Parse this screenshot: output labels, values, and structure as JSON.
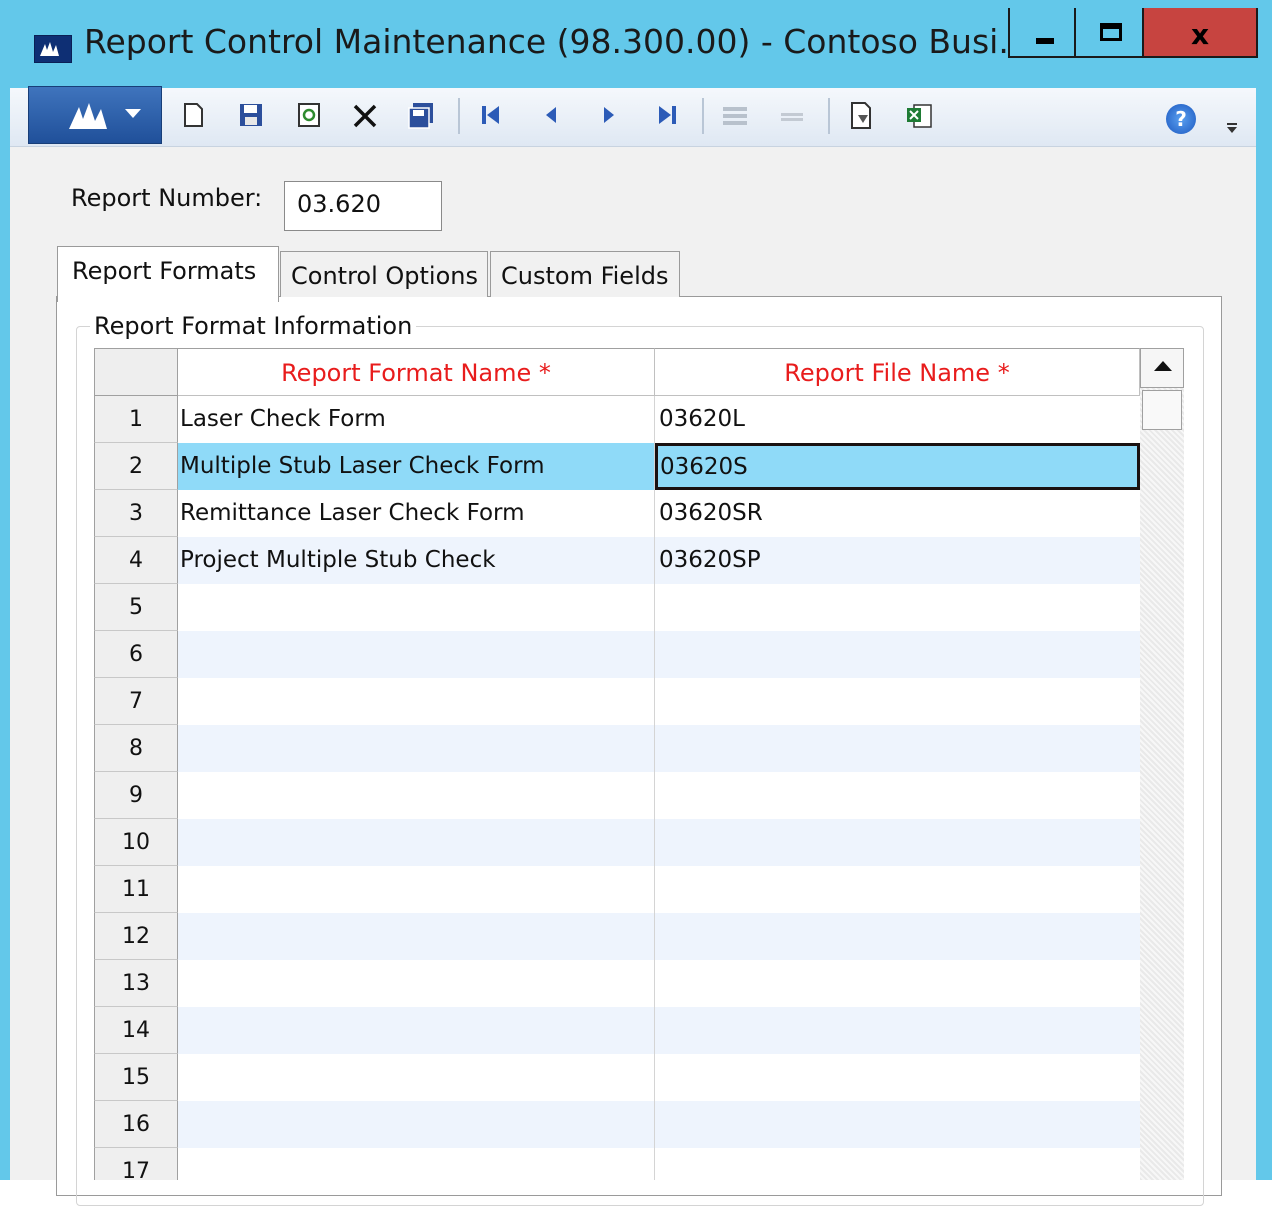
{
  "window": {
    "title": "Report Control Maintenance (98.300.00) - Contoso Busi...",
    "minimize_glyph": "",
    "close_glyph": "x"
  },
  "toolbar": {
    "menu_icon": "dynamics-menu-icon",
    "icons": [
      "new-icon",
      "save-icon",
      "refresh-icon",
      "delete-icon",
      "save-all-icon",
      "first-record-icon",
      "previous-record-icon",
      "next-record-icon",
      "last-record-icon",
      "insert-row-icon",
      "delete-row-icon",
      "print-icon",
      "export-excel-icon"
    ],
    "help_icon": "?"
  },
  "form": {
    "report_number_label": "Report Number:",
    "report_number_value": "03.620"
  },
  "tabs": [
    {
      "label": "Report Formats",
      "active": true
    },
    {
      "label": "Control Options",
      "active": false
    },
    {
      "label": "Custom Fields",
      "active": false
    }
  ],
  "group": {
    "legend": "Report Format Information"
  },
  "grid": {
    "columns": [
      "Report Format Name *",
      "Report File Name *"
    ],
    "rows": [
      {
        "num": "1",
        "name": "Laser Check Form",
        "file": "03620L"
      },
      {
        "num": "2",
        "name": "Multiple Stub Laser Check Form",
        "file": "03620S"
      },
      {
        "num": "3",
        "name": "Remittance Laser Check Form",
        "file": "03620SR"
      },
      {
        "num": "4",
        "name": "Project Multiple Stub Check",
        "file": "03620SP"
      },
      {
        "num": "5",
        "name": "",
        "file": ""
      },
      {
        "num": "6",
        "name": "",
        "file": ""
      },
      {
        "num": "7",
        "name": "",
        "file": ""
      },
      {
        "num": "8",
        "name": "",
        "file": ""
      },
      {
        "num": "9",
        "name": "",
        "file": ""
      },
      {
        "num": "10",
        "name": "",
        "file": ""
      },
      {
        "num": "11",
        "name": "",
        "file": ""
      },
      {
        "num": "12",
        "name": "",
        "file": ""
      },
      {
        "num": "13",
        "name": "",
        "file": ""
      },
      {
        "num": "14",
        "name": "",
        "file": ""
      },
      {
        "num": "15",
        "name": "",
        "file": ""
      },
      {
        "num": "16",
        "name": "",
        "file": ""
      },
      {
        "num": "17",
        "name": "",
        "file": ""
      }
    ],
    "selected_row": "2"
  }
}
